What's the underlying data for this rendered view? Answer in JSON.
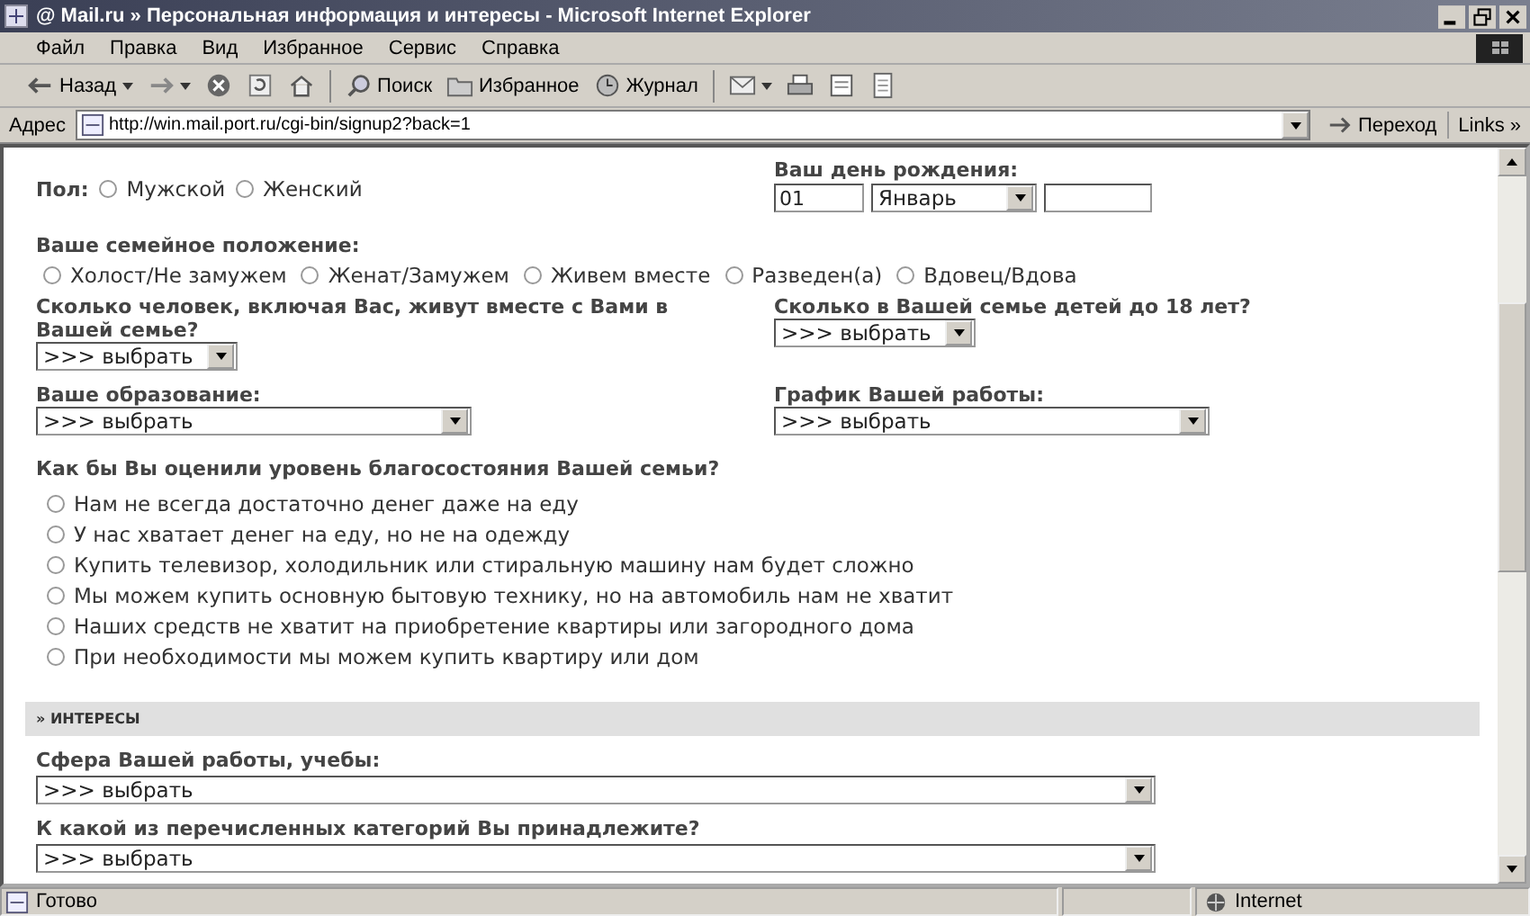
{
  "window": {
    "title": "@ Mail.ru » Персональная информация и интересы - Microsoft Internet Explorer"
  },
  "menu": [
    "Файл",
    "Правка",
    "Вид",
    "Избранное",
    "Сервис",
    "Справка"
  ],
  "toolbar": [
    {
      "kind": "back",
      "label": "Назад"
    },
    {
      "kind": "forward"
    },
    {
      "kind": "stop"
    },
    {
      "kind": "refresh"
    },
    {
      "kind": "home"
    },
    {
      "kind": "search",
      "label": "Поиск"
    },
    {
      "kind": "favorites",
      "label": "Избранное"
    },
    {
      "kind": "history",
      "label": "Журнал"
    },
    {
      "kind": "mail"
    },
    {
      "kind": "print"
    },
    {
      "kind": "edit"
    },
    {
      "kind": "discuss"
    }
  ],
  "address": {
    "label": "Адрес",
    "url": "http://win.mail.port.ru/cgi-bin/signup2?back=1",
    "go": "Переход",
    "links": "Links »"
  },
  "form": {
    "gender": {
      "label": "Пол:",
      "options": [
        {
          "label": "Мужской",
          "selected": false
        },
        {
          "label": "Женский",
          "selected": false
        }
      ]
    },
    "birthday": {
      "label": "Ваш день рождения:",
      "day": "01",
      "month": "Январь"
    },
    "marital": {
      "label": "Ваше семейное положение:",
      "options": [
        {
          "label": "Холост/Не замужем",
          "selected": false
        },
        {
          "label": "Женат/Замужем",
          "selected": false
        },
        {
          "label": "Живем вместе",
          "selected": false
        },
        {
          "label": "Разведен(а)",
          "selected": false
        },
        {
          "label": "Вдовец/Вдова",
          "selected": false
        }
      ]
    },
    "household": {
      "label": "Сколько человек, включая Вас, живут вместе с Вами в Вашей семье?",
      "value": ">>> выбрать"
    },
    "children": {
      "label": "Сколько в Вашей семье детей до 18 лет?",
      "value": ">>> выбрать"
    },
    "education": {
      "label": "Ваше образование:",
      "value": ">>> выбрать"
    },
    "schedule": {
      "label": "График Вашей работы:",
      "value": ">>> выбрать"
    },
    "wealth": {
      "label": "Как бы Вы оценили уровень благосостояния Вашей семьи?",
      "options": [
        {
          "label": "Нам не всегда достаточно денег даже на еду",
          "selected": false
        },
        {
          "label": "У нас хватает денег на еду, но не на одежду",
          "selected": false
        },
        {
          "label": "Купить телевизор, холодильник или стиральную машину нам будет сложно",
          "selected": false
        },
        {
          "label": "Мы можем купить основную бытовую технику, но на автомобиль нам не хватит",
          "selected": false
        },
        {
          "label": "Наших средств не хватит на приобретение квартиры или загородного дома",
          "selected": false
        },
        {
          "label": "При необходимости мы можем купить квартиру или дом",
          "selected": false
        }
      ]
    },
    "interests": {
      "header": "» ИНТЕРЕСЫ",
      "fields": [
        {
          "label": "Сфера Вашей работы, учебы:",
          "value": ">>> выбрать"
        },
        {
          "label": "К какой из перечисленных категорий Вы принадлежите?",
          "value": ">>> выбрать"
        }
      ]
    }
  },
  "status": {
    "text": "Готово",
    "zone": "Internet"
  }
}
